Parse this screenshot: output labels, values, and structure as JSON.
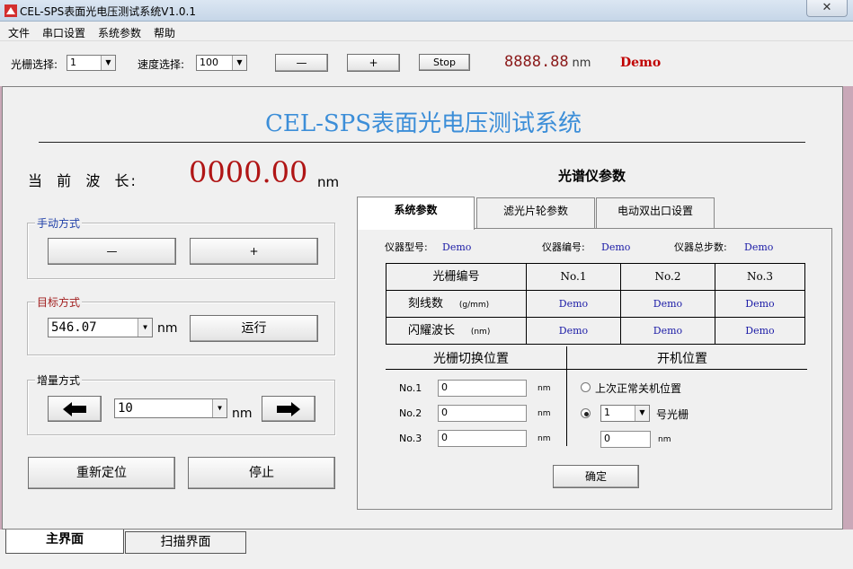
{
  "window": {
    "title": "CEL-SPS表面光电压测试系统V1.0.1",
    "close_glyph": "✕"
  },
  "menu": [
    "文件",
    "串口设置",
    "系统参数",
    "帮助"
  ],
  "toolbar": {
    "grating_label": "光栅选择:",
    "grating_value": "1",
    "speed_label": "速度选择:",
    "speed_value": "100",
    "minus_label": "—",
    "plus_label": "+",
    "stop_label": "Stop",
    "wavelength_readout": "8888.88",
    "wavelength_unit": "nm",
    "demo": "Demo"
  },
  "main": {
    "title": "CEL-SPS表面光电压测试系统",
    "current_wl_label": "当  前  波  长:",
    "current_wl_value": "0000.00",
    "current_wl_unit": "nm",
    "manual": {
      "title": "手动方式",
      "minus": "—",
      "plus": "+"
    },
    "target": {
      "title": "目标方式",
      "value": "546.07",
      "unit": "nm",
      "run": "运行"
    },
    "increment": {
      "title": "增量方式",
      "value": "10",
      "unit": "nm"
    },
    "reposition": "重新定位",
    "stop": "停止"
  },
  "spectrometer": {
    "title": "光谱仪参数",
    "tabs": [
      "系统参数",
      "滤光片轮参数",
      "电动双出口设置"
    ],
    "model_label": "仪器型号:",
    "model_value": "Demo",
    "serial_label": "仪器编号:",
    "serial_value": "Demo",
    "steps_label": "仪器总步数:",
    "steps_value": "Demo",
    "table": {
      "headers": [
        "光栅编号",
        "No.1",
        "No.2",
        "No.3"
      ],
      "rows": [
        {
          "label": "刻线数",
          "unit": "(g/mm)",
          "values": [
            "Demo",
            "Demo",
            "Demo"
          ]
        },
        {
          "label": "闪耀波长",
          "unit": "(nm)",
          "values": [
            "Demo",
            "Demo",
            "Demo"
          ]
        }
      ]
    },
    "switch_pos": {
      "title": "光栅切换位置",
      "rows": [
        {
          "label": "No.1",
          "value": "0",
          "unit": "nm"
        },
        {
          "label": "No.2",
          "value": "0",
          "unit": "nm"
        },
        {
          "label": "No.3",
          "value": "0",
          "unit": "nm"
        }
      ]
    },
    "startup": {
      "title": "开机位置",
      "radio1": "上次正常关机位置",
      "grating_value": "1",
      "grating_suffix": "号光栅",
      "pos_value": "0",
      "pos_unit": "nm"
    },
    "confirm": "确定"
  },
  "bottom_tabs": [
    "主界面",
    "扫描界面"
  ]
}
